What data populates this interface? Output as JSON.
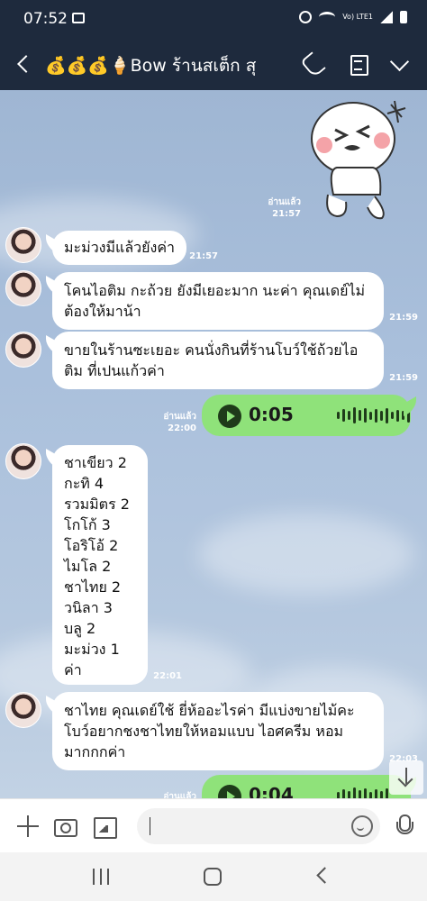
{
  "status_bar": {
    "time": "07:52",
    "network": "Vo) LTE1"
  },
  "header": {
    "title": "💰💰💰🍦Bow ร้านสเต็ก สุ"
  },
  "messages": [
    {
      "type": "sticker",
      "direction": "out",
      "read": "อ่านแล้ว",
      "time": "21:57"
    },
    {
      "type": "text",
      "direction": "in",
      "text": "มะม่วงมีแล้วยังค่า",
      "time": "21:57"
    },
    {
      "type": "text",
      "direction": "in",
      "lines": [
        "โคนไอติม  กะถ้วย ยังมีเยอะมาก นะค่า คุณเดย์ไม่",
        "ต้องให้มาน้า"
      ],
      "time": "21:59"
    },
    {
      "type": "text",
      "direction": "in",
      "lines": [
        "ขายในร้านซะเยอะ คนนั่งกินที่ร้านโบว์ใช้ถ้วยไอ",
        "ติม ที่เปนแก้วค่า"
      ],
      "time": "21:59"
    },
    {
      "type": "voice",
      "direction": "out",
      "duration": "0:05",
      "read": "อ่านแล้ว",
      "time": "22:00"
    },
    {
      "type": "text",
      "direction": "in",
      "lines": [
        "ชาเขียว 2",
        "กะทิ 4",
        "รวมมิตร 2",
        "โกโก้ 3",
        "โอริโอ้ 2",
        "ไมโล 2",
        "ชาไทย 2",
        "วนิลา 3",
        "บลู 2",
        "มะม่วง 1 ค่า"
      ],
      "time": "22:01"
    },
    {
      "type": "text",
      "direction": "in",
      "lines": [
        "ชาไทย คุณเดย์ใช้ ยี่ห้ออะไรค่า มีแบ่งขายไม้คะ",
        "โบว์อยากชงชาไทยให้หอมแบบ ไอศครีม หอม",
        "มากกกค่า"
      ],
      "time": "22:03"
    },
    {
      "type": "voice",
      "direction": "out",
      "duration": "0:04",
      "read": "อ่านแล้ว",
      "time": ""
    }
  ],
  "input": {
    "placeholder": "",
    "value": ""
  },
  "colors": {
    "header_bg": "#1e2a3d",
    "voice_bubble": "#8fe27a",
    "incoming_bubble": "#ffffff"
  }
}
